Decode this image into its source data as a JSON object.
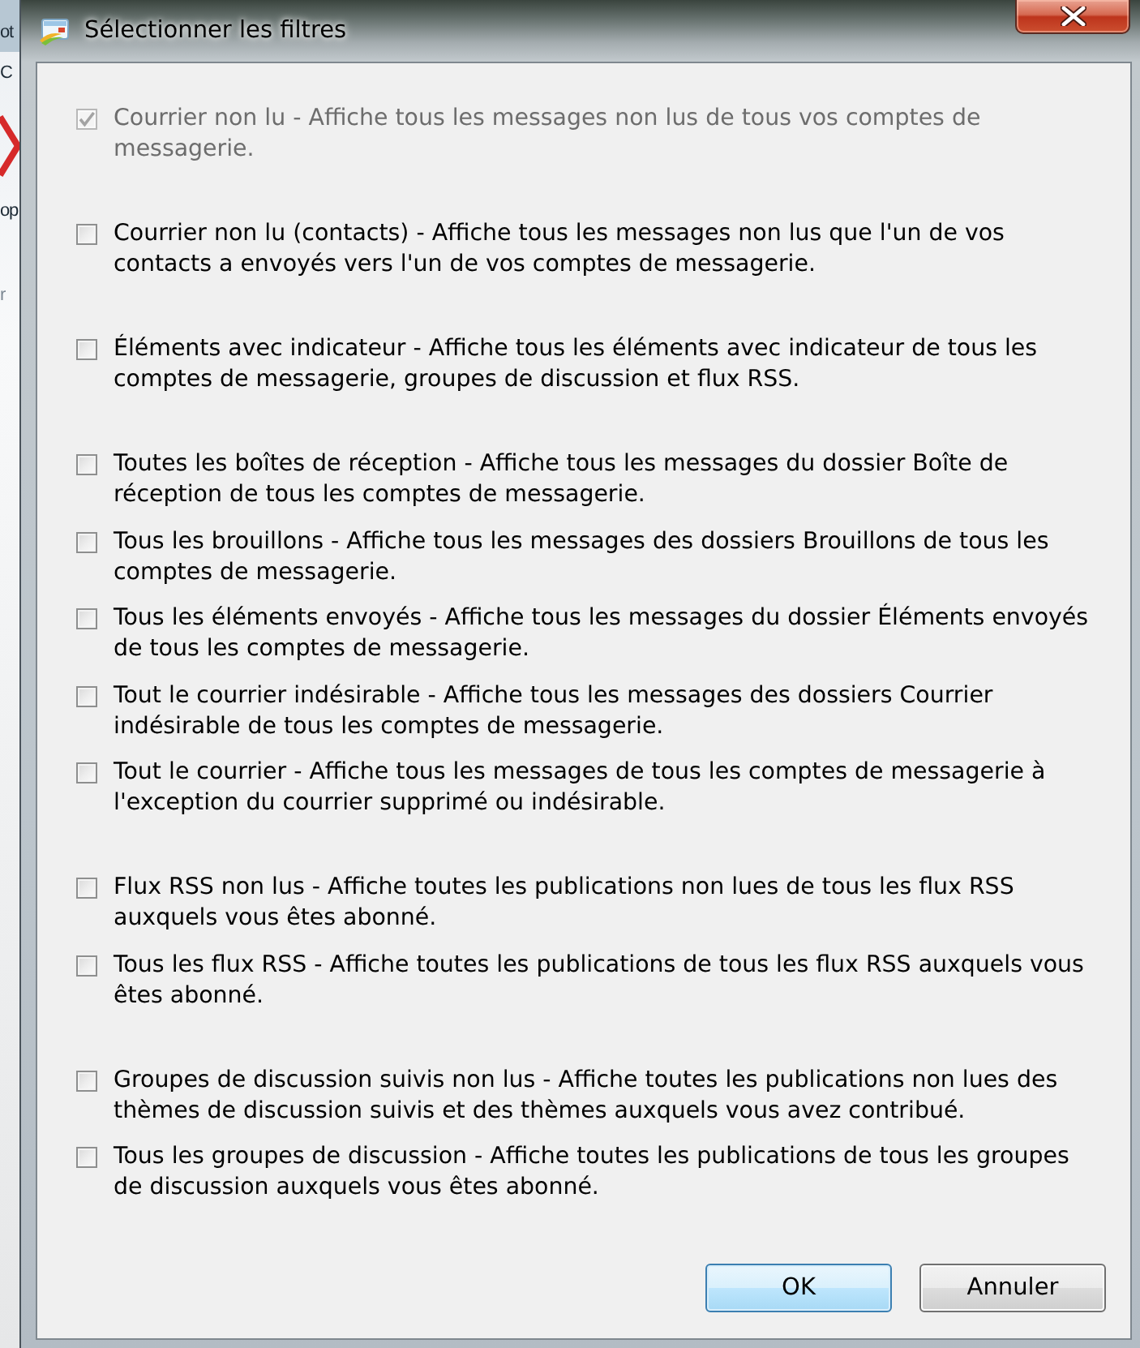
{
  "window": {
    "title": "Sélectionner les filtres"
  },
  "background_window": {
    "texts": [
      "ot",
      "C",
      "op",
      "r"
    ]
  },
  "filter_groups": [
    {
      "items": [
        {
          "label": "Courrier non lu - Affiche tous les messages non lus de tous vos comptes de messagerie.",
          "checked": true,
          "disabled": true
        }
      ]
    },
    {
      "items": [
        {
          "label": "Courrier non lu (contacts) - Affiche tous les messages non lus que l'un de vos contacts a envoyés vers l'un de vos comptes de messagerie.",
          "checked": false,
          "disabled": false
        }
      ]
    },
    {
      "items": [
        {
          "label": "Éléments avec indicateur - Affiche tous les éléments avec indicateur de tous les comptes de messagerie, groupes de discussion et flux RSS.",
          "checked": false,
          "disabled": false
        }
      ]
    },
    {
      "items": [
        {
          "label": "Toutes les boîtes de réception - Affiche tous les messages du dossier Boîte de réception de tous les comptes de messagerie.",
          "checked": false,
          "disabled": false
        },
        {
          "label": "Tous les brouillons - Affiche tous les messages des dossiers Brouillons de tous les comptes de messagerie.",
          "checked": false,
          "disabled": false
        },
        {
          "label": "Tous les éléments envoyés - Affiche tous les messages du dossier Éléments envoyés de tous les comptes de messagerie.",
          "checked": false,
          "disabled": false
        },
        {
          "label": "Tout le courrier indésirable - Affiche tous les messages des dossiers Courrier indésirable de tous les comptes de messagerie.",
          "checked": false,
          "disabled": false
        },
        {
          "label": "Tout le courrier - Affiche tous les messages de tous les comptes de messagerie à l'exception du courrier supprimé ou indésirable.",
          "checked": false,
          "disabled": false
        }
      ]
    },
    {
      "items": [
        {
          "label": "Flux RSS non lus - Affiche toutes les publications non lues de tous les flux RSS auxquels vous êtes abonné.",
          "checked": false,
          "disabled": false
        },
        {
          "label": "Tous les flux RSS - Affiche toutes les publications de tous les flux RSS auxquels vous êtes abonné.",
          "checked": false,
          "disabled": false
        }
      ]
    },
    {
      "items": [
        {
          "label": "Groupes de discussion suivis non lus - Affiche toutes les publications non lues des thèmes de discussion suivis et des thèmes auxquels vous avez contribué.",
          "checked": false,
          "disabled": false
        },
        {
          "label": "Tous les groupes de discussion - Affiche toutes les publications de tous les groupes de discussion auxquels vous êtes abonné.",
          "checked": false,
          "disabled": false
        }
      ]
    }
  ],
  "buttons": [
    {
      "label": "OK",
      "default": true
    },
    {
      "label": "Annuler",
      "default": false
    }
  ]
}
